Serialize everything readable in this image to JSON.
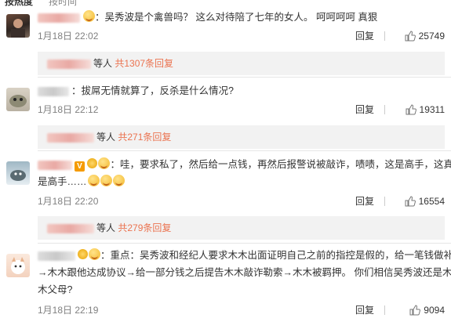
{
  "header": {
    "tab_hot": "按热度",
    "tab_time": "按时间"
  },
  "comments": [
    {
      "name": "",
      "text": "：吴秀波是个禽兽吗？ 这么对待陪了七年的女人。 呵呵呵呵 真狠",
      "time": "1月18日 22:02",
      "reply": "回复",
      "likes": "25749",
      "sub_suffix": "等人",
      "sub_more": "共1307条回复"
    },
    {
      "name": "",
      "text": "：拔屌无情就算了，反杀是什么情况?",
      "time": "1月18日 22:12",
      "reply": "回复",
      "likes": "19311",
      "sub_suffix": "等人",
      "sub_more": "共271条回复"
    },
    {
      "name": "",
      "text_line1": "：哇，要求私了，然后给一点钱，再然后报警说被敲诈，啧啧，这是高手，这真",
      "text_line2": "是高手……",
      "time": "1月18日 22:20",
      "reply": "回复",
      "likes": "16554",
      "sub_suffix": "等人",
      "sub_more": "共279条回复"
    },
    {
      "name": "",
      "text_line1": "：重点：吴秀波和经纪人要求木木出面证明自己之前的指控是假的，给一笔钱做补偿",
      "text_line2": "→木木跟他达成协议→给一部分钱之后提告木木敲诈勒索→木木被羁押。 你们相信吴秀波还是木",
      "text_line3": "木父母?",
      "time": "1月18日 22:19",
      "reply": "回复",
      "likes": "9094"
    }
  ],
  "icons": {
    "like": "thumbs-up-icon",
    "emoji": "smile-emoji-icon",
    "vip": "v-badge-icon",
    "medal": "medal-icon"
  },
  "colors": {
    "accent": "#eb7350",
    "sub_bg": "#f2f2f2",
    "meta": "#808080"
  }
}
